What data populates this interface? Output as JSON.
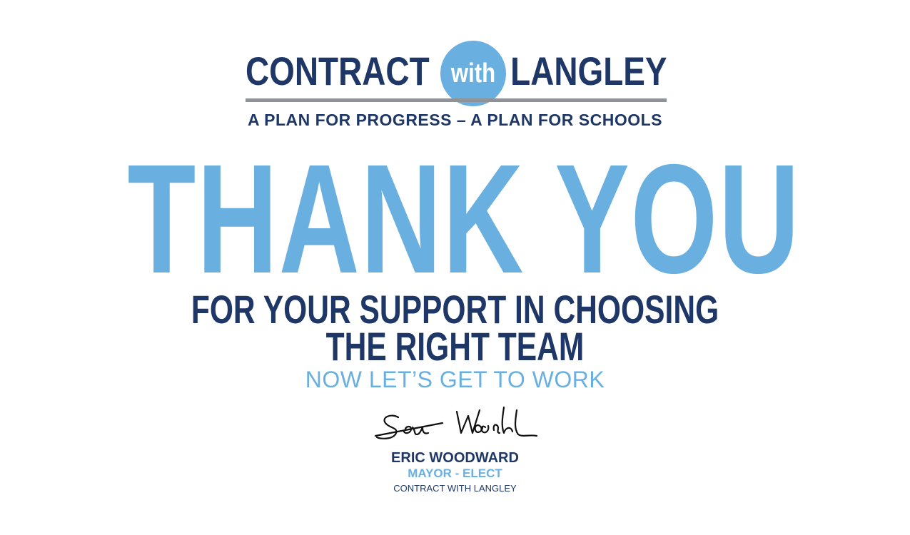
{
  "logo": {
    "left_text": "CONTRACT",
    "circle_text": "with",
    "right_text": "LANGLEY"
  },
  "tagline": "A PLAN FOR PROGRESS – A PLAN FOR SCHOOLS",
  "headline": "THANK YOU",
  "support": {
    "line1": "FOR YOUR SUPPORT IN CHOOSING",
    "line2": "THE RIGHT TEAM"
  },
  "subline": "NOW LET’S GET TO WORK",
  "signoff": {
    "name": "ERIC WOODWARD",
    "role": "MAYOR - ELECT",
    "org": "CONTRACT WITH LANGLEY"
  },
  "colors": {
    "navy": "#1e3766",
    "light_blue": "#69b0e1",
    "rule_gray": "#8f9296"
  }
}
